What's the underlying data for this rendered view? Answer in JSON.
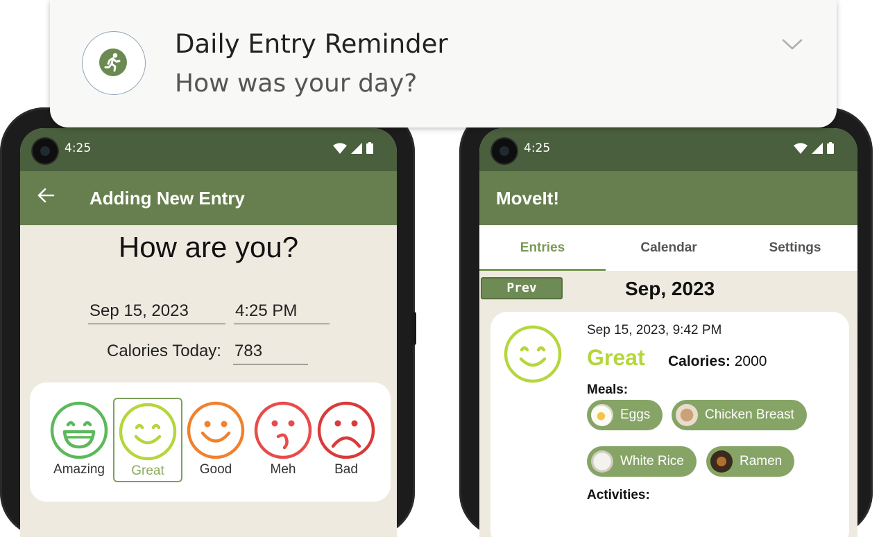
{
  "notification": {
    "title": "Daily Entry Reminder",
    "body": "How was your day?",
    "icon": "running-person-icon",
    "expand_icon": "chevron-down-icon"
  },
  "left_phone": {
    "status": {
      "time": "4:25"
    },
    "appbar": {
      "title": "Adding New Entry",
      "back_icon": "arrow-left-icon"
    },
    "headline": "How are you?",
    "date_value": "Sep 15, 2023",
    "time_value": "4:25 PM",
    "calories_label": "Calories Today:",
    "calories_value": "783",
    "moods": [
      {
        "label": "Amazing",
        "color": "#5cb85c"
      },
      {
        "label": "Great",
        "color": "#b5d63c",
        "selected": true
      },
      {
        "label": "Good",
        "color": "#f0812d"
      },
      {
        "label": "Meh",
        "color": "#e84b4b"
      },
      {
        "label": "Bad",
        "color": "#d93a3a"
      }
    ]
  },
  "right_phone": {
    "status": {
      "time": "4:25"
    },
    "appbar": {
      "title": "MoveIt!"
    },
    "tabs": [
      {
        "label": "Entries",
        "active": true
      },
      {
        "label": "Calendar"
      },
      {
        "label": "Settings"
      }
    ],
    "prev_label": "Prev",
    "month": "Sep, 2023",
    "entry": {
      "date": "Sep 15, 2023, 9:42 PM",
      "mood": "Great",
      "calories_key": "Calories:",
      "calories_value": "2000",
      "meals_label": "Meals:",
      "meals": [
        "Eggs",
        "Chicken Breast",
        "White Rice",
        "Ramen"
      ],
      "activities_label": "Activities:"
    }
  },
  "colors": {
    "status_bar": "#4a5f3d",
    "app_bar": "#677f4f",
    "accent": "#7a9a55",
    "chip": "#86a466",
    "background": "#eeeae0"
  }
}
